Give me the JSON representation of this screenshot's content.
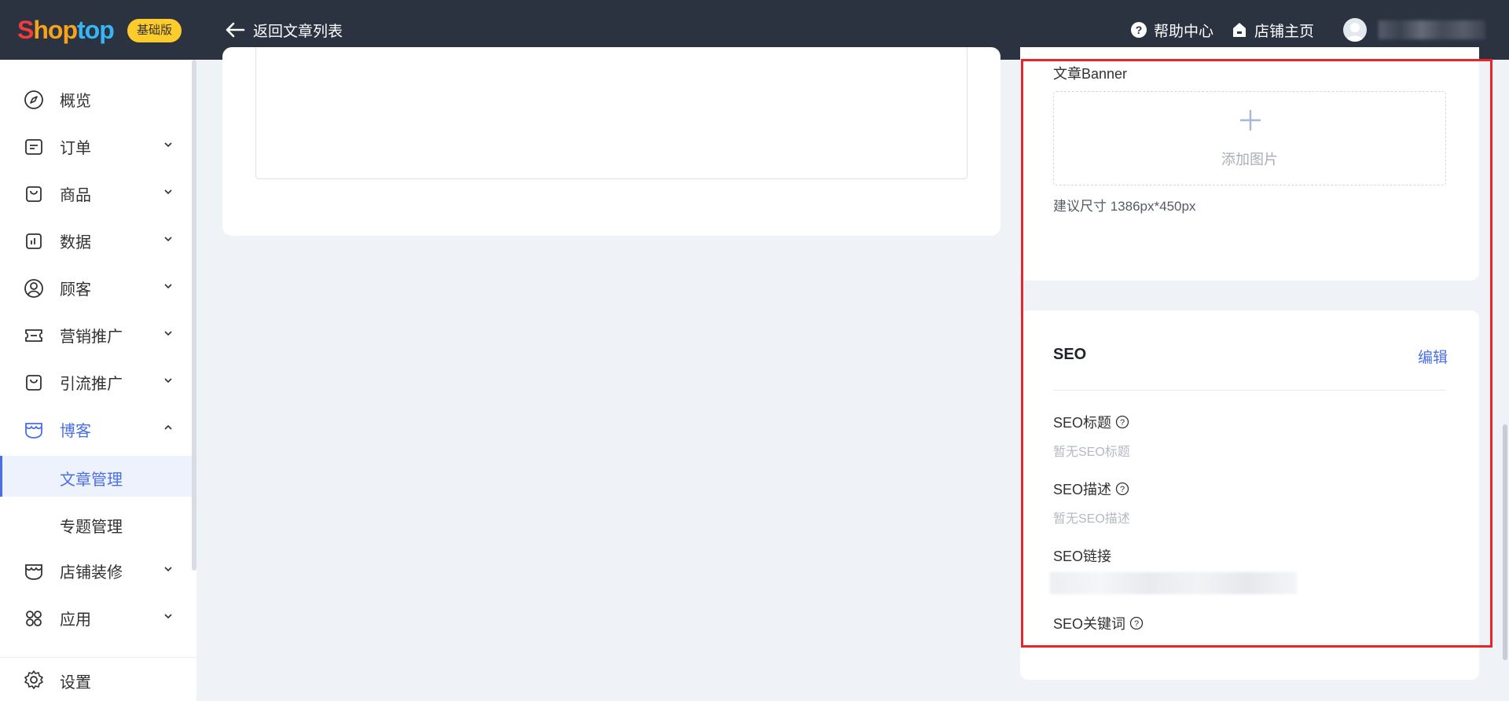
{
  "topbar": {
    "logo": {
      "part1": "S",
      "part2": "hop",
      "part3": "top"
    },
    "badge": "基础版",
    "back_label": "返回文章列表",
    "help_label": "帮助中心",
    "store_label": "店铺主页"
  },
  "sidebar": {
    "items": [
      {
        "label": "概览",
        "icon": "compass-icon",
        "has_chevron": false
      },
      {
        "label": "订单",
        "icon": "order-icon",
        "has_chevron": true
      },
      {
        "label": "商品",
        "icon": "bag-icon",
        "has_chevron": true
      },
      {
        "label": "数据",
        "icon": "chart-icon",
        "has_chevron": true
      },
      {
        "label": "顾客",
        "icon": "user-icon",
        "has_chevron": true
      },
      {
        "label": "营销推广",
        "icon": "ticket-icon",
        "has_chevron": true
      },
      {
        "label": "引流推广",
        "icon": "bag-icon",
        "has_chevron": true
      },
      {
        "label": "博客",
        "icon": "blog-icon",
        "has_chevron": true,
        "expanded": true
      },
      {
        "label": "店铺装修",
        "icon": "store-icon",
        "has_chevron": true
      },
      {
        "label": "应用",
        "icon": "apps-icon",
        "has_chevron": true
      }
    ],
    "sub_items": [
      {
        "label": "文章管理",
        "selected": true
      },
      {
        "label": "专题管理",
        "selected": false
      }
    ],
    "settings_label": "设置"
  },
  "banner": {
    "label": "文章Banner",
    "add_image": "添加图片",
    "hint": "建议尺寸 1386px*450px"
  },
  "seo": {
    "title": "SEO",
    "edit": "编辑",
    "title_label": "SEO标题",
    "title_value": "暂无SEO标题",
    "desc_label": "SEO描述",
    "desc_value": "暂无SEO描述",
    "link_label": "SEO链接",
    "keywords_label": "SEO关键词"
  },
  "colors": {
    "accent": "#4a6fe6",
    "topbar": "#2b3240",
    "badge": "#fccb2c",
    "highlight": "#e8262a"
  }
}
